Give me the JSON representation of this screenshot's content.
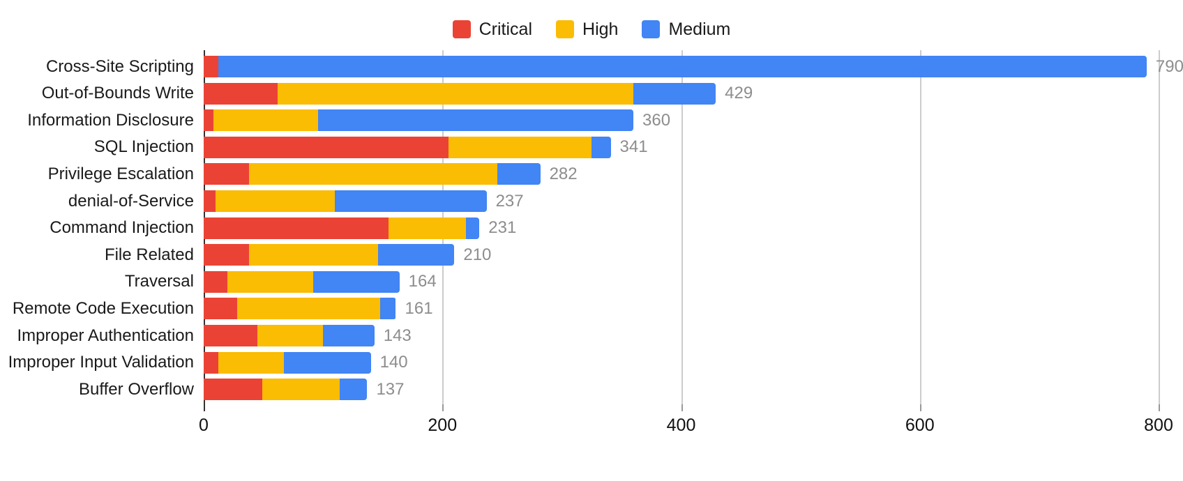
{
  "chart_data": {
    "type": "bar",
    "orientation": "horizontal",
    "stacked": true,
    "title": "",
    "subtitle": "",
    "xlabel": "",
    "ylabel": "",
    "xlim": [
      0,
      800
    ],
    "xticks": [
      "0",
      "200",
      "400",
      "600",
      "800"
    ],
    "xtick_values": [
      0,
      200,
      400,
      600,
      800
    ],
    "grid": "vertical",
    "legend_position": "top-center",
    "legend": [
      "Critical",
      "High",
      "Medium"
    ],
    "colors": {
      "Critical": "#ea4335",
      "High": "#fbbc04",
      "Medium": "#4285f4",
      "axis": "#333333",
      "gridline": "#cccccc",
      "total_label": "#8d8d8d",
      "text": "#1a1a1a",
      "background": "#ffffff"
    },
    "categories": [
      "Cross-Site Scripting",
      "Out-of-Bounds Write",
      "Information Disclosure",
      "SQL Injection",
      "Privilege Escalation",
      "denial-of-Service",
      "Command Injection",
      "File Related",
      "Traversal",
      "Remote Code Execution",
      "Improper Authentication",
      "Improper Input Validation",
      "Buffer Overflow"
    ],
    "series": [
      {
        "name": "Critical",
        "color": "#ea4335",
        "values": [
          12,
          62,
          8,
          205,
          38,
          10,
          155,
          38,
          20,
          28,
          45,
          12,
          49
        ]
      },
      {
        "name": "High",
        "color": "#fbbc04",
        "values": [
          0,
          298,
          88,
          120,
          208,
          100,
          65,
          108,
          72,
          120,
          55,
          55,
          65
        ]
      },
      {
        "name": "Medium",
        "color": "#4285f4",
        "values": [
          778,
          69,
          264,
          16,
          36,
          127,
          11,
          64,
          72,
          13,
          43,
          73,
          23
        ]
      }
    ],
    "totals": [
      790,
      429,
      360,
      341,
      282,
      237,
      231,
      210,
      164,
      161,
      143,
      140,
      137
    ],
    "total_labels": [
      "790",
      "429",
      "360",
      "341",
      "282",
      "237",
      "231",
      "210",
      "164",
      "161",
      "143",
      "140",
      "137"
    ]
  }
}
